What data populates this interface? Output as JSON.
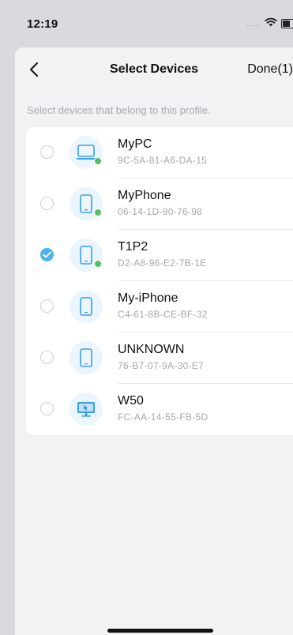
{
  "status": {
    "time": "12:19",
    "signal": "....."
  },
  "nav": {
    "title": "Select Devices",
    "done_label": "Done(1)"
  },
  "hint": "Select devices that belong to this profile.",
  "devices": [
    {
      "name": "MyPC",
      "mac": "9C-5A-81-A6-DA-15",
      "icon": "laptop-icon",
      "online": true,
      "selected": false
    },
    {
      "name": "MyPhone",
      "mac": "06-14-1D-90-76-98",
      "icon": "phone-icon",
      "online": true,
      "selected": false
    },
    {
      "name": "T1P2",
      "mac": "D2-A8-96-E2-7B-1E",
      "icon": "phone-icon",
      "online": true,
      "selected": true
    },
    {
      "name": "My-iPhone",
      "mac": "C4-61-8B-CE-BF-32",
      "icon": "phone-icon",
      "online": false,
      "selected": false
    },
    {
      "name": "UNKNOWN",
      "mac": "76-B7-07-9A-30-E7",
      "icon": "phone-icon",
      "online": false,
      "selected": false
    },
    {
      "name": "W50",
      "mac": "FC-AA-14-55-FB-5D",
      "icon": "monitor-icon",
      "online": false,
      "selected": false
    }
  ],
  "colors": {
    "accent": "#4cb2ee",
    "online": "#4fc063",
    "icon_bg": "#eaf5fd"
  }
}
